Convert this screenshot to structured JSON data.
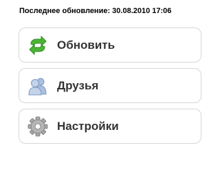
{
  "status": {
    "text": "Последнее обновление: 30.08.2010 17:06"
  },
  "menu": {
    "items": [
      {
        "label": "Обновить",
        "icon": "refresh-icon",
        "icon_color": "#3fae2a"
      },
      {
        "label": "Друзья",
        "icon": "friends-icon",
        "icon_color": "#8aa8d0"
      },
      {
        "label": "Настройки",
        "icon": "settings-icon",
        "icon_color": "#9a9a9a"
      }
    ]
  }
}
